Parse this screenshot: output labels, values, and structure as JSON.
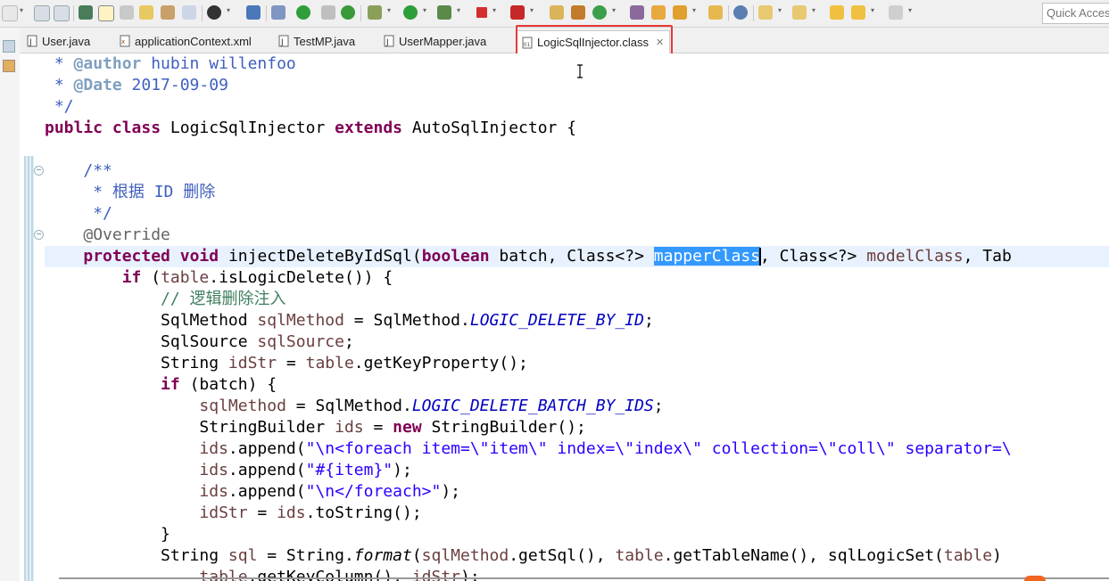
{
  "toolbar": {
    "quick_access_placeholder": "Quick Access",
    "icons": [
      "new-icon",
      "save-icon",
      "save-all-icon",
      "cut-icon",
      "edit-icon",
      "pen-icon",
      "refresh-icon",
      "terminal-icon",
      "paragraph-icon",
      "settings-icon",
      "console-icon",
      "skip-icon",
      "run-circle-icon",
      "open-type-icon",
      "update-icon",
      "debug-icon",
      "run-icon",
      "run-coverage-icon",
      "stop-icon",
      "external-tool-icon",
      "open-type-hierarchy-icon",
      "build-icon",
      "refresh-green-icon",
      "folder-icon",
      "open-folder-icon",
      "rocket-icon",
      "open-file-icon",
      "globe-icon",
      "next-annotation-icon",
      "prev-annotation-icon",
      "last-edit-icon",
      "back-icon",
      "forward-icon"
    ]
  },
  "tabs": [
    {
      "label": "User.java",
      "icon": "java-file-icon"
    },
    {
      "label": "applicationContext.xml",
      "icon": "xml-file-icon"
    },
    {
      "label": "TestMP.java",
      "icon": "java-file-icon"
    },
    {
      "label": "UserMapper.java",
      "icon": "java-file-icon"
    },
    {
      "label": "LogicSqlInjector.class",
      "icon": "class-file-icon",
      "active": true
    }
  ],
  "colors": {
    "keyword": "#7f0055",
    "javadoc": "#3f5fbf",
    "comment": "#3f7f5f",
    "string": "#2a00ff",
    "static_field": "#0000c0",
    "local_variable": "#6a3e3e",
    "annotation": "#646464",
    "selection": "#3399ff",
    "highlight_box": "#e53935",
    "current_line": "#e8f2fe"
  },
  "code": {
    "l01_star": " * ",
    "l01_tag": "@author",
    "l01_text": " hubin willenfoo",
    "l02_star": " * ",
    "l02_tag": "@Date",
    "l02_text": " 2017-09-09",
    "l03_end": " */",
    "l04_public": "public",
    "l04_class": "class",
    "l04_name": " LogicSqlInjector ",
    "l04_extends": "extends",
    "l04_rest": " AutoSqlInjector {",
    "l06_doc": "/**",
    "l07_doc": " * 根据 ID 删除",
    "l08_doc": " */",
    "l09_ann": "@Override",
    "l10_protected": "protected",
    "l10_void": "void",
    "l10_method": " injectDeleteByIdSql(",
    "l10_boolean": "boolean",
    "l10_batch": " batch, Class<?> ",
    "l10_selected": "mapperClass",
    "l10_after": ", Class<?> ",
    "l10_model": "modelClass",
    "l10_tail": ", Tab",
    "l11_if": "if",
    "l11_open": " (",
    "l11_table": "table",
    "l11_rest": ".isLogicDelete()) {",
    "l12_comment": "// 逻辑删除注入",
    "l13_type": "SqlMethod ",
    "l13_var": "sqlMethod",
    "l13_eq": " = SqlMethod.",
    "l13_field": "LOGIC_DELETE_BY_ID",
    "l13_end": ";",
    "l14_type": "SqlSource ",
    "l14_var": "sqlSource",
    "l14_end": ";",
    "l15_type": "String ",
    "l15_var": "idStr",
    "l15_eq": " = ",
    "l15_table": "table",
    "l15_rest": ".getKeyProperty();",
    "l16_if": "if",
    "l16_rest": " (batch) {",
    "l17_var": "sqlMethod",
    "l17_eq": " = SqlMethod.",
    "l17_field": "LOGIC_DELETE_BATCH_BY_IDS",
    "l17_end": ";",
    "l18_type": "StringBuilder ",
    "l18_var": "ids",
    "l18_eq": " = ",
    "l18_new": "new",
    "l18_rest": " StringBuilder();",
    "l19_var": "ids",
    "l19_call": ".append(",
    "l19_str": "\"\\n<foreach item=\\\"item\\\" index=\\\"index\\\" collection=\\\"coll\\\" separator=\\",
    "l20_var": "ids",
    "l20_call": ".append(",
    "l20_str": "\"#{item}\"",
    "l20_end": ");",
    "l21_var": "ids",
    "l21_call": ".append(",
    "l21_str": "\"\\n</foreach>\"",
    "l21_end": ");",
    "l22_var": "idStr",
    "l22_eq": " = ",
    "l22_ids": "ids",
    "l22_rest": ".toString();",
    "l23_brace": "}",
    "l24_type": "String ",
    "l24_var": "sql",
    "l24_eq": " = String.",
    "l24_format": "format",
    "l24_open": "(",
    "l24_sqlm": "sqlMethod",
    "l24_mid1": ".getSql(), ",
    "l24_table": "table",
    "l24_mid2": ".getTableName(), sqlLogicSet(",
    "l24_table2": "table",
    "l24_tail": ")",
    "l25_table": "table",
    "l25_rest": ".getKeyColumn(), ",
    "l25_var": "idStr",
    "l25_end": ");"
  }
}
